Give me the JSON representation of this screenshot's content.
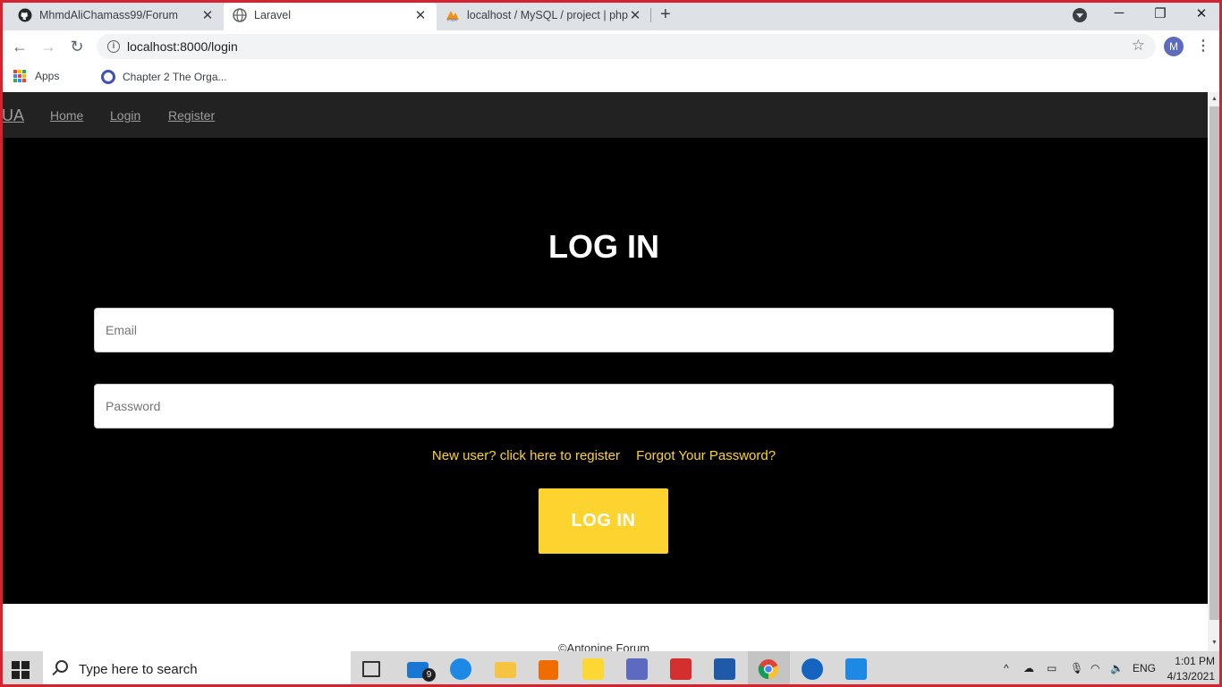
{
  "browser": {
    "tabs": [
      {
        "title": "MhmdAliChamass99/Forum",
        "icon": "github-icon"
      },
      {
        "title": "Laravel",
        "icon": "globe-icon",
        "active": true
      },
      {
        "title": "localhost / MySQL / project | php",
        "icon": "phpmyadmin-icon"
      }
    ],
    "url": "localhost:8000/login",
    "profile_initial": "M",
    "bookmarks": [
      {
        "label": "Apps",
        "icon": "apps-grid-icon"
      },
      {
        "label": "Chapter 2 The Orga...",
        "icon": "quizlet-icon"
      }
    ]
  },
  "site": {
    "brand": "UA",
    "nav": [
      "Home",
      "Login",
      "Register"
    ],
    "title": "LOG IN",
    "email_placeholder": "Email",
    "password_placeholder": "Password",
    "register_link": "New user? click here to register",
    "forgot_link": "Forgot Your Password?",
    "submit_label": "LOG IN",
    "footer": "©Antonine Forum"
  },
  "taskbar": {
    "search_placeholder": "Type here to search",
    "mail_badge": "9",
    "language": "ENG",
    "time": "1:01 PM",
    "date": "4/13/2021"
  },
  "colors": {
    "accent": "#fdd330",
    "nav_bg": "#222222",
    "hero_bg": "#000000",
    "chrome_frame": "#d6212f"
  }
}
